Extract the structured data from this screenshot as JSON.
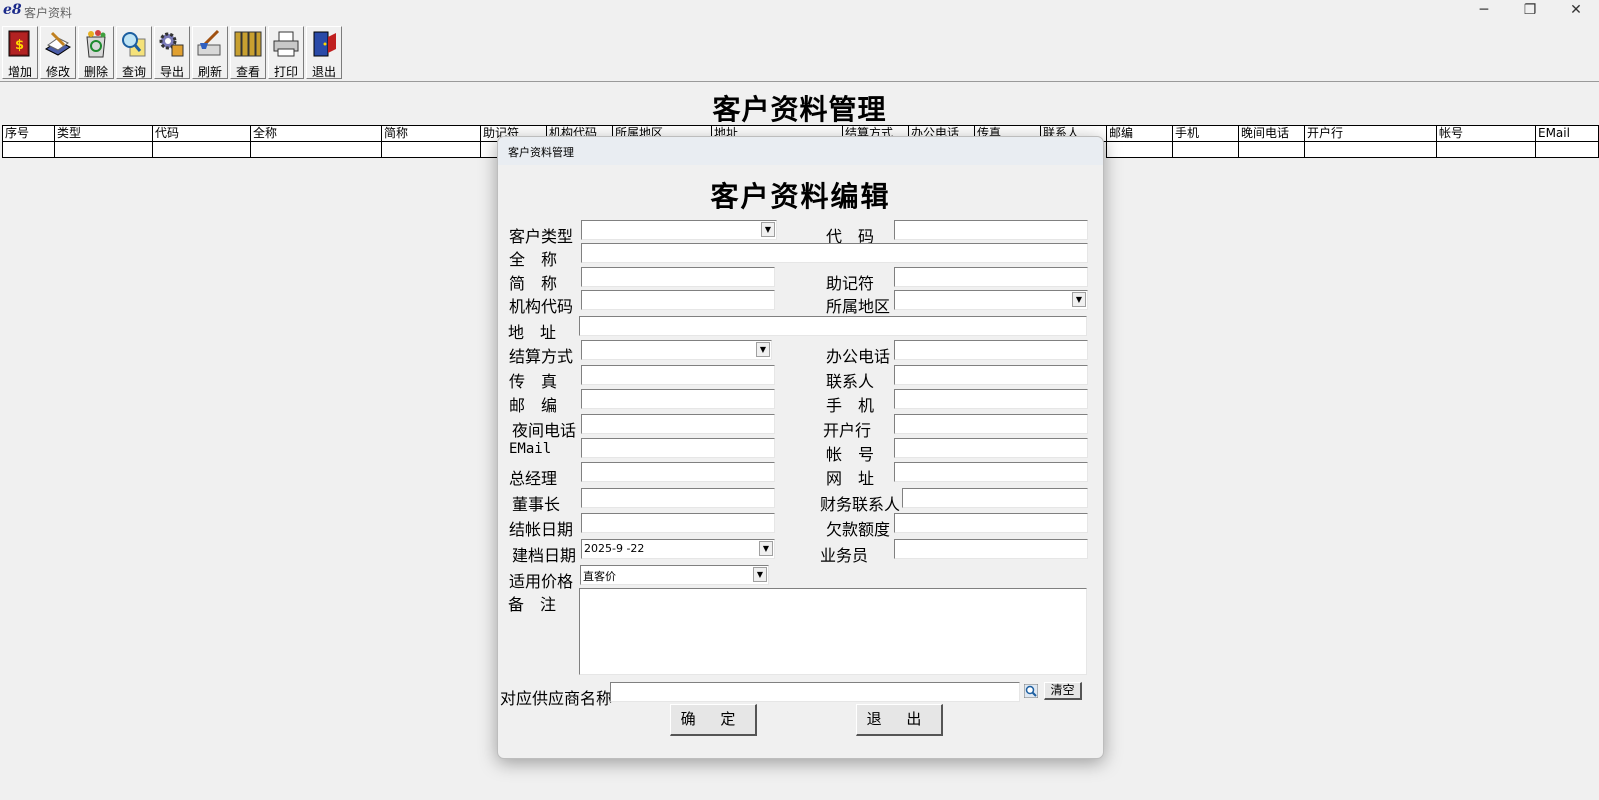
{
  "app": {
    "logo": "e8",
    "title": "客户资料",
    "controls": {
      "minimize": "─",
      "restore": "❐",
      "close": "✕"
    }
  },
  "toolbar": [
    {
      "label": "增加",
      "icon": "add-book-icon"
    },
    {
      "label": "修改",
      "icon": "edit-book-icon"
    },
    {
      "label": "删除",
      "icon": "recycle-bin-icon"
    },
    {
      "label": "查询",
      "icon": "magnifier-icon"
    },
    {
      "label": "导出",
      "icon": "export-gear-icon"
    },
    {
      "label": "刷新",
      "icon": "refresh-brush-icon"
    },
    {
      "label": "查看",
      "icon": "view-binders-icon"
    },
    {
      "label": "打印",
      "icon": "printer-icon"
    },
    {
      "label": "退出",
      "icon": "exit-door-icon"
    }
  ],
  "main": {
    "title": "客户资料管理",
    "columns": [
      "序号",
      "类型",
      "代码",
      "全称",
      "简称",
      "助记符",
      "机构代码",
      "所属地区",
      "地址",
      "结算方式",
      "办公电话",
      "传真",
      "联系人",
      "邮编",
      "手机",
      "晚间电话",
      "开户行",
      "帐号",
      "EMail"
    ]
  },
  "dialog": {
    "caption": "客户资料管理",
    "heading": "客户资料编辑",
    "labels": {
      "customer_type": "客户类型",
      "code": "代　码",
      "full_name": "全　称",
      "short_name": "简　称",
      "mnemonic": "助记符",
      "org_code": "机构代码",
      "region": "所属地区",
      "address": "地　址",
      "settlement": "结算方式",
      "office_phone": "办公电话",
      "fax": "传　真",
      "contact": "联系人",
      "postcode": "邮　编",
      "mobile": "手　机",
      "night_phone": "夜间电话",
      "bank": "开户行",
      "email": "EMail",
      "account": "帐　号",
      "gm": "总经理",
      "website": "网　址",
      "chairman": "董事长",
      "finance_contact": "财务联系人",
      "closing_date": "结帐日期",
      "credit_limit": "欠款额度",
      "created_date": "建档日期",
      "salesperson": "业务员",
      "price": "适用价格",
      "remark": "备　注",
      "supplier": "对应供应商名称"
    },
    "values": {
      "created_date": "2025-9 -22",
      "price": "直客价"
    },
    "buttons": {
      "clear": "清空",
      "confirm": "确 定",
      "exit": "退 出"
    }
  }
}
